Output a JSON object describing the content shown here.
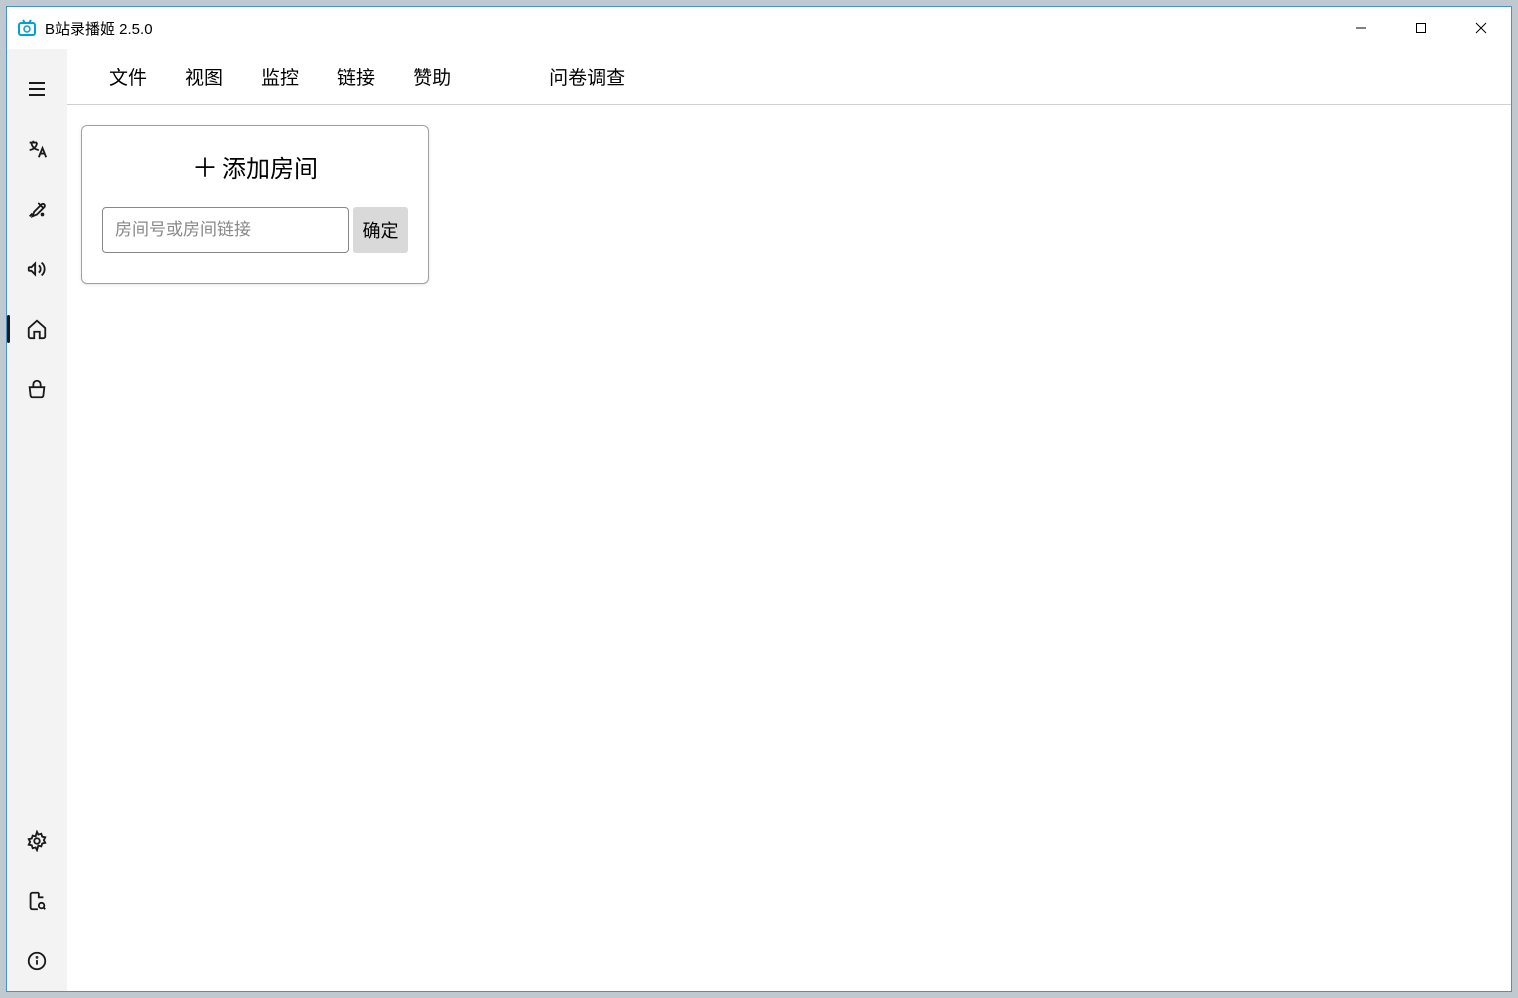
{
  "window": {
    "title": "B站录播姬 2.5.0"
  },
  "menubar": {
    "file": "文件",
    "view": "视图",
    "monitor": "监控",
    "link": "链接",
    "sponsor": "赞助",
    "survey": "问卷调查"
  },
  "addRoom": {
    "title": "添加房间",
    "placeholder": "房间号或房间链接",
    "confirm": "确定"
  }
}
